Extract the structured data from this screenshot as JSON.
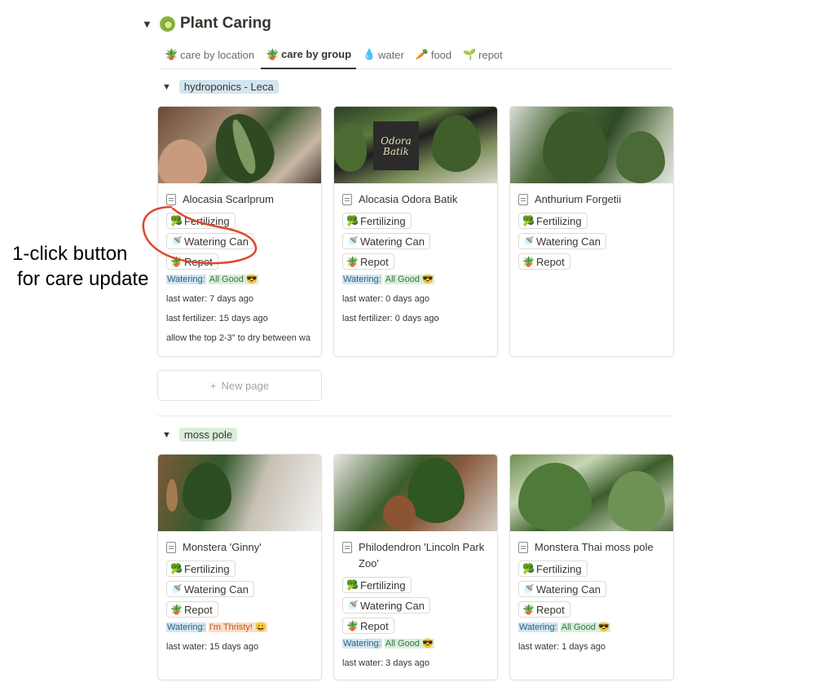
{
  "page": {
    "title": "Plant Caring",
    "title_emoji": "kiwi-icon"
  },
  "tabs": [
    {
      "label": "care by location",
      "icon": "cactus-icon",
      "active": false
    },
    {
      "label": "care by group",
      "icon": "cactus-icon",
      "active": true
    },
    {
      "label": "water",
      "icon": "droplet-icon",
      "active": false
    },
    {
      "label": "food",
      "icon": "carrot-icon",
      "active": false
    },
    {
      "label": "repot",
      "icon": "potted-plant-icon",
      "active": false
    }
  ],
  "buttons": {
    "fertilizing": "Fertilizing",
    "watering_can": "Watering Can",
    "repot": "Repot"
  },
  "status": {
    "watering_label": "Watering:",
    "all_good": "All Good 😎",
    "thirsty": "I'm Thristy! 😀"
  },
  "groups": [
    {
      "name": "hydroponics - Leca",
      "color": "#d3e5ef",
      "cards": [
        {
          "title": "Alocasia Scarlprum",
          "watering_status": "All Good 😎",
          "last_water": "last water: 7 days ago",
          "last_fertilizer": "last fertilizer: 15 days ago",
          "note": "allow the top 2-3\" to dry between wa"
        },
        {
          "title": "Alocasia Odora Batik",
          "watering_status": "All Good 😎",
          "last_water": "last water: 0 days ago",
          "last_fertilizer": "last fertilizer: 0 days ago",
          "image_sign": "Odora Batik"
        },
        {
          "title": "Anthurium Forgetii"
        }
      ],
      "new_page": "New page"
    },
    {
      "name": "moss pole",
      "color": "#dbeddb",
      "cards": [
        {
          "title": "Monstera 'Ginny'",
          "watering_status": "I'm Thristy! 😀",
          "last_water": "last water: 15 days ago"
        },
        {
          "title": "Philodendron 'Lincoln Park Zoo'",
          "watering_status": "All Good 😎",
          "last_water": "last water: 3 days ago"
        },
        {
          "title": "Monstera Thai moss pole",
          "watering_status": "All Good 😎",
          "last_water": "last water: 1 days ago"
        }
      ]
    }
  ],
  "annotation": {
    "line1": "1-click button",
    "line2": "for care update",
    "color": "#e0452b"
  }
}
